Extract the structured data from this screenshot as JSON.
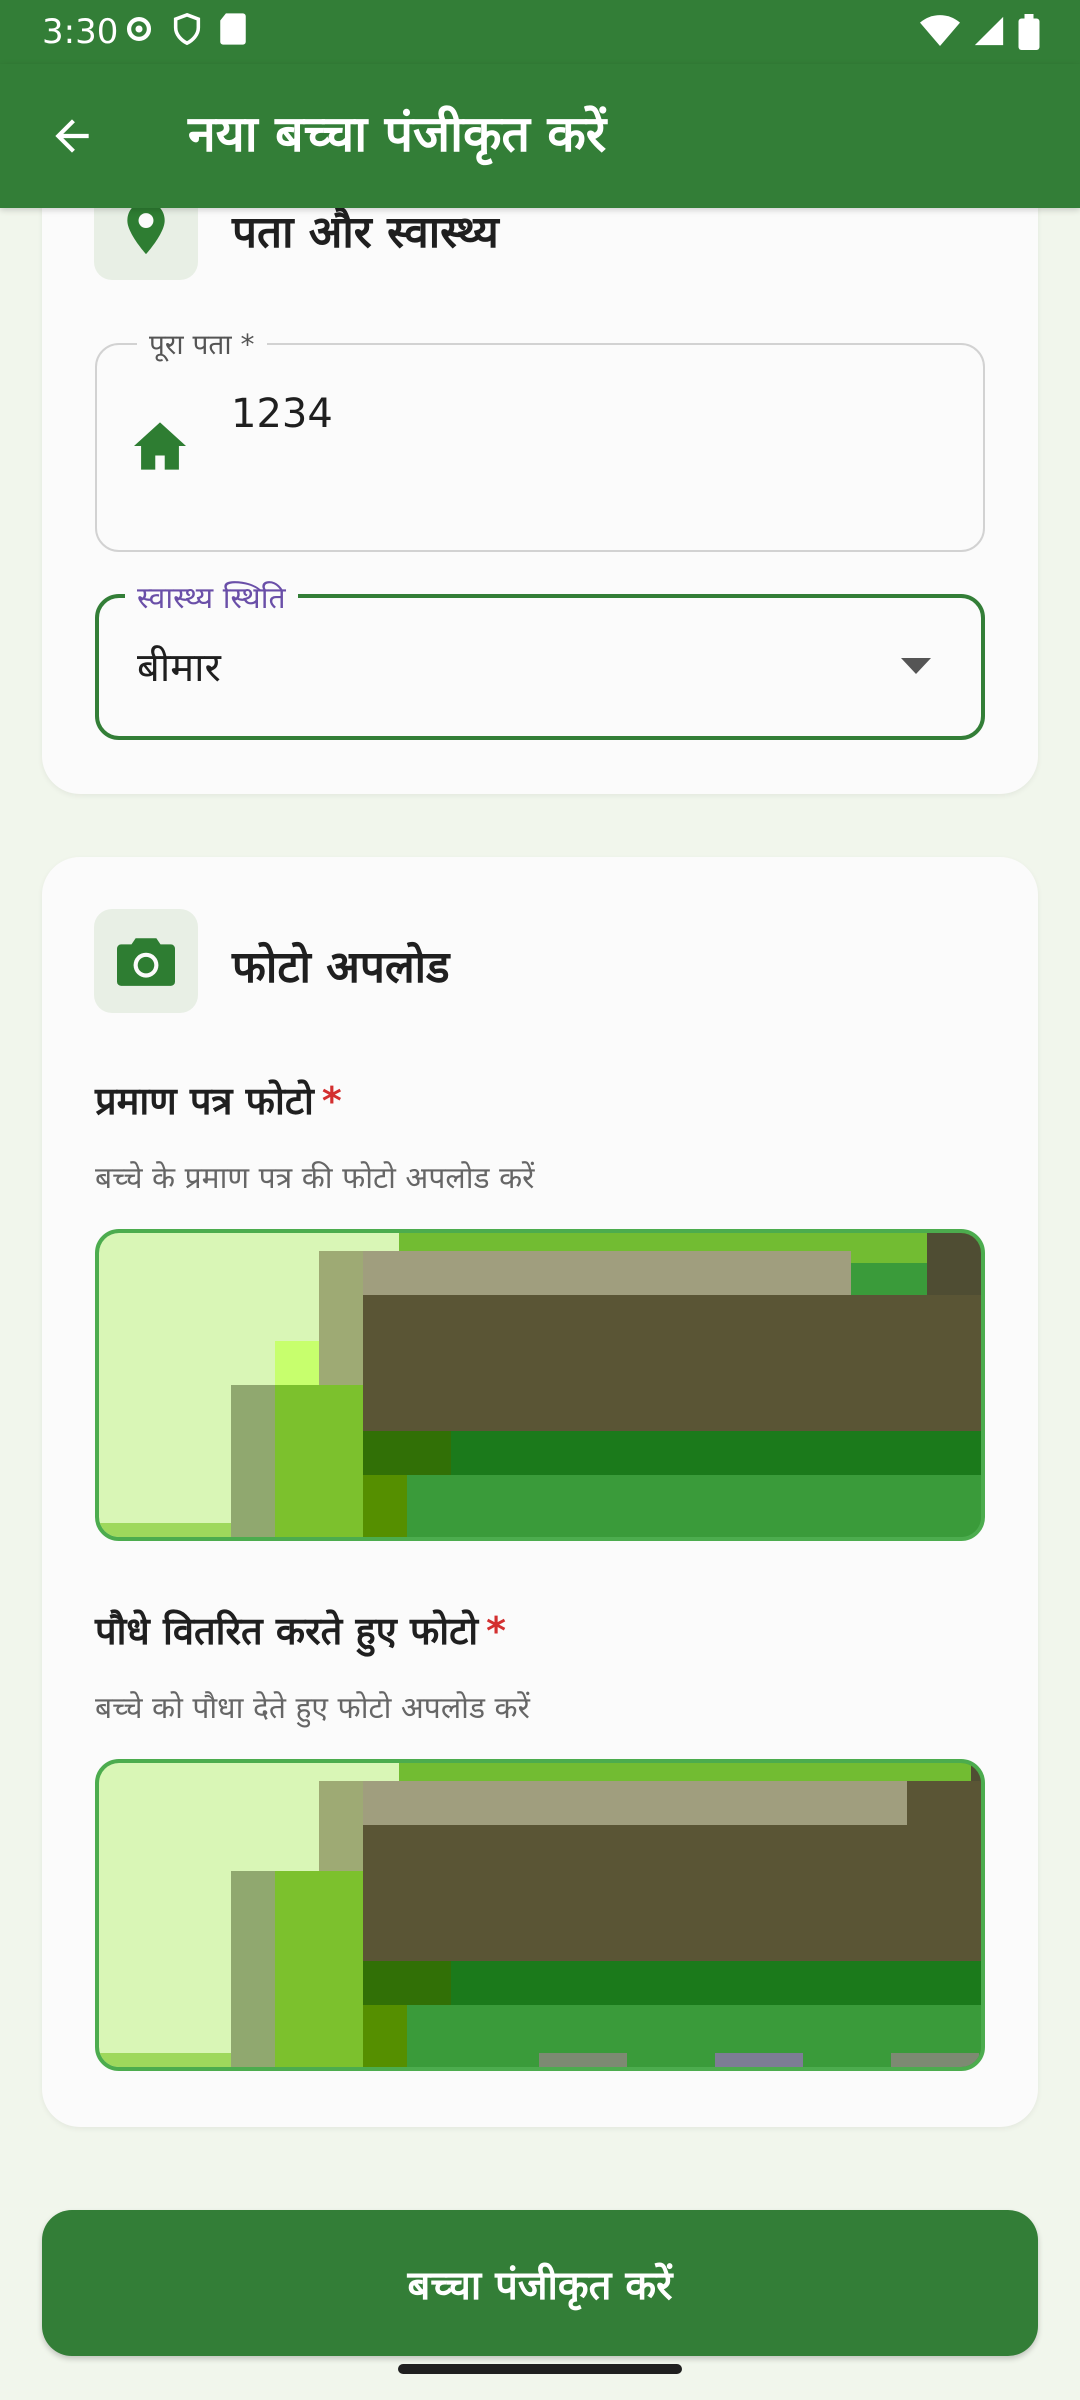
{
  "status_bar": {
    "time": "3:30",
    "left_icons": [
      "gear-icon",
      "shield-icon",
      "sd-card-icon"
    ],
    "right_icons": [
      "wifi-icon",
      "signal-icon",
      "battery-icon"
    ]
  },
  "app_bar": {
    "title": "नया बच्चा पंजीकृत करें",
    "back_icon": "arrow-back-icon"
  },
  "address_section": {
    "title": "पता और स्वास्थ्य",
    "icon": "location-pin-icon",
    "address_field": {
      "label": "पूरा पता *",
      "value": "1234",
      "icon": "home-icon"
    },
    "health_field": {
      "label": "स्वास्थ्य स्थिति",
      "value": "बीमार",
      "icon": "dropdown-arrow-icon"
    }
  },
  "photo_section": {
    "title": "फोटो अपलोड",
    "icon": "camera-icon",
    "certificate": {
      "label": "प्रमाण पत्र फोटो",
      "required": "*",
      "hint": "बच्चे के प्रमाण पत्र की फोटो अपलोड करें"
    },
    "plant": {
      "label": "पौधे वितरित करते हुए फोटो",
      "required": "*",
      "hint": "बच्चे को पौधा देते हुए फोटो अपलोड करें"
    }
  },
  "submit": {
    "label": "बच्चा पंजीकृत करें"
  },
  "colors": {
    "primary": "#337e37",
    "accent_border": "#4cac4e",
    "required": "#d32f2f",
    "label_purple": "#6a4fa8"
  }
}
